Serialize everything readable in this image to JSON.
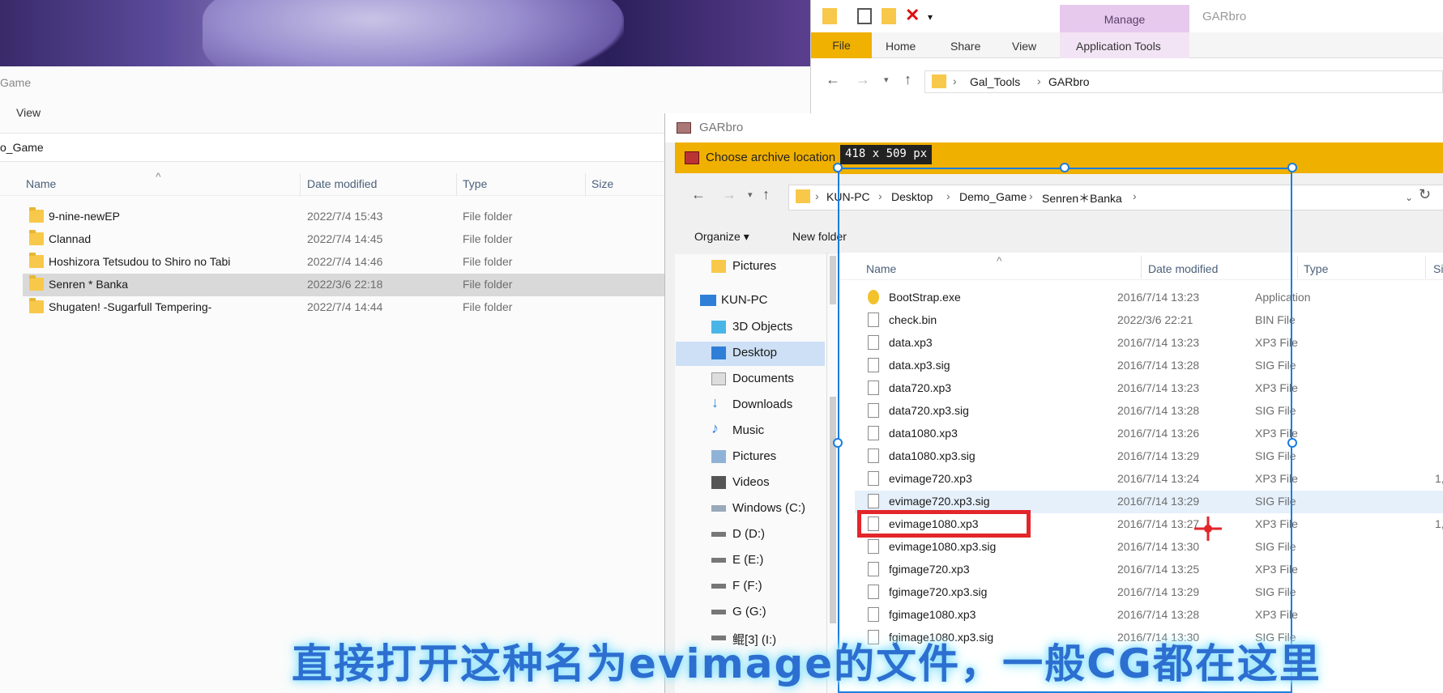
{
  "left_window": {
    "title_fragment": "Game",
    "menu_view": "View",
    "address_fragment": "o_Game",
    "columns": {
      "name": "Name",
      "date": "Date modified",
      "type": "Type",
      "size": "Size"
    },
    "rows": [
      {
        "name": "9-nine-newEP",
        "date": "2022/7/4 15:43",
        "type": "File folder"
      },
      {
        "name": "Clannad",
        "date": "2022/7/4 14:45",
        "type": "File folder"
      },
      {
        "name": "Hoshizora Tetsudou to Shiro no Tabi",
        "date": "2022/7/4 14:46",
        "type": "File folder"
      },
      {
        "name": "Senren * Banka",
        "date": "2022/3/6 22:18",
        "type": "File folder"
      },
      {
        "name": "Shugaten! -Sugarfull Tempering-",
        "date": "2022/7/4 14:44",
        "type": "File folder"
      }
    ]
  },
  "ribbon_window": {
    "manage": "Manage",
    "title": "GARbro",
    "tabs": {
      "file": "File",
      "home": "Home",
      "share": "Share",
      "view": "View",
      "app_tools": "Application Tools"
    },
    "breadcrumb": [
      "Gal_Tools",
      "GARbro"
    ]
  },
  "garbro": {
    "title": "GARbro",
    "dialog_title": "Choose archive location",
    "breadcrumb": [
      "KUN-PC",
      "Desktop",
      "Demo_Game",
      "Senren＊Banka"
    ],
    "organize": "Organize",
    "new_folder": "New folder",
    "columns": {
      "name": "Name",
      "date": "Date modified",
      "type": "Type",
      "size": "Si"
    },
    "nav": [
      {
        "label": "Pictures"
      },
      {
        "label": "KUN-PC"
      },
      {
        "label": "3D Objects"
      },
      {
        "label": "Desktop"
      },
      {
        "label": "Documents"
      },
      {
        "label": "Downloads"
      },
      {
        "label": "Music"
      },
      {
        "label": "Pictures"
      },
      {
        "label": "Videos"
      },
      {
        "label": "Windows (C:)"
      },
      {
        "label": "D (D:)"
      },
      {
        "label": "E (E:)"
      },
      {
        "label": "F (F:)"
      },
      {
        "label": "G (G:)"
      },
      {
        "label": "鲲[3] (I:)"
      }
    ],
    "files": [
      {
        "name": "BootStrap.exe",
        "date": "2016/7/14 13:23",
        "type": "Application",
        "size": ""
      },
      {
        "name": "check.bin",
        "date": "2022/3/6 22:21",
        "type": "BIN File",
        "size": ""
      },
      {
        "name": "data.xp3",
        "date": "2016/7/14 13:23",
        "type": "XP3 File",
        "size": ""
      },
      {
        "name": "data.xp3.sig",
        "date": "2016/7/14 13:28",
        "type": "SIG File",
        "size": ""
      },
      {
        "name": "data720.xp3",
        "date": "2016/7/14 13:23",
        "type": "XP3 File",
        "size": ""
      },
      {
        "name": "data720.xp3.sig",
        "date": "2016/7/14 13:28",
        "type": "SIG File",
        "size": ""
      },
      {
        "name": "data1080.xp3",
        "date": "2016/7/14 13:26",
        "type": "XP3 File",
        "size": ""
      },
      {
        "name": "data1080.xp3.sig",
        "date": "2016/7/14 13:29",
        "type": "SIG File",
        "size": ""
      },
      {
        "name": "evimage720.xp3",
        "date": "2016/7/14 13:24",
        "type": "XP3 File",
        "size": "1,"
      },
      {
        "name": "evimage720.xp3.sig",
        "date": "2016/7/14 13:29",
        "type": "SIG File",
        "size": ""
      },
      {
        "name": "evimage1080.xp3",
        "date": "2016/7/14 13:27",
        "type": "XP3 File",
        "size": "1,"
      },
      {
        "name": "evimage1080.xp3.sig",
        "date": "2016/7/14 13:30",
        "type": "SIG File",
        "size": ""
      },
      {
        "name": "fgimage720.xp3",
        "date": "2016/7/14 13:25",
        "type": "XP3 File",
        "size": ""
      },
      {
        "name": "fgimage720.xp3.sig",
        "date": "2016/7/14 13:29",
        "type": "SIG File",
        "size": ""
      },
      {
        "name": "fgimage1080.xp3",
        "date": "2016/7/14 13:28",
        "type": "XP3 File",
        "size": ""
      },
      {
        "name": "fgimage1080.xp3.sig",
        "date": "2016/7/14 13:30",
        "type": "SIG File",
        "size": ""
      }
    ]
  },
  "overlay": {
    "dimensions": "418 x 509  px",
    "caption": "直接打开这种名为evimage的文件，一般CG都在这里"
  },
  "colors": {
    "accent": "#f0b000",
    "selection": "#1a7de0",
    "highlight": "#e3262a",
    "caption": "#2d6fd0"
  }
}
